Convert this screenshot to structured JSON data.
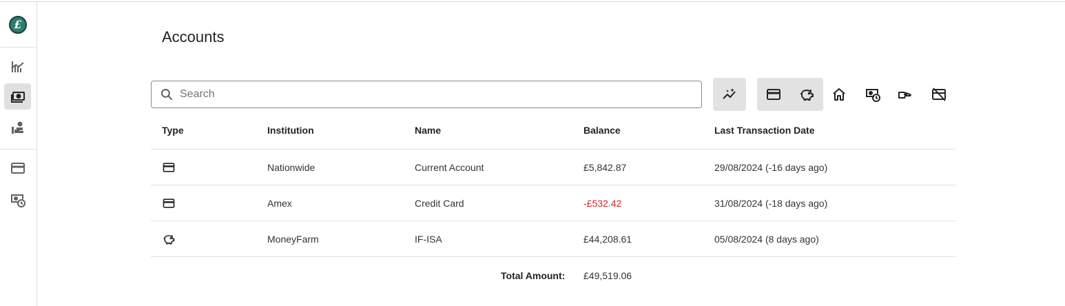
{
  "app": {
    "logo_glyph": "£"
  },
  "page": {
    "title": "Accounts"
  },
  "search": {
    "placeholder": "Search",
    "value": ""
  },
  "sidebar": {
    "items": [
      {
        "icon": "chart-icon",
        "active": false
      },
      {
        "icon": "accounts-icon",
        "active": true
      },
      {
        "icon": "hand-person-icon",
        "active": false
      },
      {
        "icon": "credit-card-icon",
        "active": false
      },
      {
        "icon": "money-clock-icon",
        "active": false
      }
    ]
  },
  "toolbar": {
    "buttons": [
      {
        "icon": "insights-icon",
        "selected": true
      },
      {
        "icon": "credit-card-icon",
        "selected": true
      },
      {
        "icon": "piggy-bank-icon",
        "selected": true
      },
      {
        "icon": "home-icon",
        "selected": false
      },
      {
        "icon": "money-clock-icon",
        "selected": false
      },
      {
        "icon": "hand-icon",
        "selected": false
      },
      {
        "icon": "card-off-icon",
        "selected": false
      }
    ]
  },
  "table": {
    "headers": [
      "Type",
      "Institution",
      "Name",
      "Balance",
      "Last Transaction Date"
    ],
    "rows": [
      {
        "type_icon": "credit-card-icon",
        "institution": "Nationwide",
        "name": "Current Account",
        "balance": "£5,842.87",
        "last_transaction": "29/08/2024 (-16 days ago)"
      },
      {
        "type_icon": "credit-card-icon",
        "institution": "Amex",
        "name": "Credit Card",
        "balance": "-£532.42",
        "last_transaction": "31/08/2024 (-18 days ago)"
      },
      {
        "type_icon": "piggy-bank-icon",
        "institution": "MoneyFarm",
        "name": "IF-ISA",
        "balance": "£44,208.61",
        "last_transaction": "05/08/2024 (8 days ago)"
      }
    ],
    "total_label": "Total Amount:",
    "total_value": "£49,519.06"
  },
  "colors": {
    "negative": "#e02020",
    "logo": "#2e7d70",
    "selected_bg": "#e2e2e2"
  }
}
